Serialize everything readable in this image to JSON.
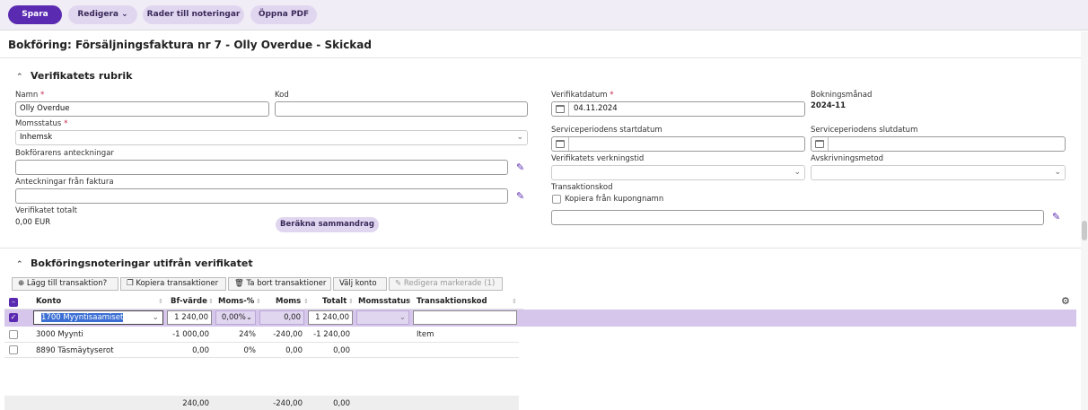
{
  "toolbar": {
    "save_label": "Spara",
    "edit_label": "Redigera",
    "rows_label": "Rader till noteringar",
    "pdf_label": "Öppna PDF"
  },
  "page": {
    "title": "Bokföring: Försäljningsfaktura nr 7 - Olly Overdue - Skickad"
  },
  "header_section": {
    "title": "Verifikatets rubrik",
    "name_label": "Namn",
    "name_value": "Olly Overdue",
    "code_label": "Kod",
    "code_value": "",
    "vat_status_label": "Momsstatus",
    "vat_status_value": "Inhemsk",
    "bookkeeper_notes_label": "Bokförarens anteckningar",
    "bookkeeper_notes_value": "",
    "invoice_notes_label": "Anteckningar från faktura",
    "invoice_notes_value": "",
    "total_label": "Verifikatet totalt",
    "total_value": "0,00 EUR",
    "calc_button": "Beräkna sammandrag",
    "date_label": "Verifikatdatum",
    "date_value": "04.11.2024",
    "booking_month_label": "Bokningsmånad",
    "booking_month_value": "2024-11",
    "service_start_label": "Serviceperiodens startdatum",
    "service_end_label": "Serviceperiodens slutdatum",
    "effect_time_label": "Verifikatets verkningstid",
    "depreciation_label": "Avskrivningsmetod",
    "transaction_code_label": "Transaktionskod",
    "copy_coupon_label": "Kopiera från kupongnamn",
    "required_mark": "*"
  },
  "entries_section": {
    "title": "Bokföringsnoteringar utifrån verifikatet",
    "buttons": {
      "add": "Lägg till transaktion?",
      "copy": "Kopiera transaktioner",
      "delete": "Ta bort transaktioner",
      "choose": "Välj konto",
      "edit_marked": "Redigera markerade (1)"
    },
    "columns": [
      "Konto",
      "Bf-värde",
      "Moms-%",
      "Moms",
      "Totalt",
      "Momsstatus",
      "Transaktionskod"
    ],
    "rows": [
      {
        "account": "1700 Myyntisaamiset",
        "bf": "1 240,00",
        "vat_pct": "0,00%",
        "vat": "0,00",
        "total": "1 240,00",
        "vat_status": "",
        "code": "",
        "selected": true
      },
      {
        "account": "3000 Myynti",
        "bf": "-1 000,00",
        "vat_pct": "24%",
        "vat": "-240,00",
        "total": "-1 240,00",
        "vat_status": "",
        "code": "Item",
        "selected": false
      },
      {
        "account": "8890 Täsmäytyserot",
        "bf": "0,00",
        "vat_pct": "0%",
        "vat": "0,00",
        "total": "0,00",
        "vat_status": "",
        "code": "",
        "selected": false
      }
    ],
    "footer": {
      "bf": "240,00",
      "vat": "-240,00",
      "total": "0,00"
    }
  },
  "icons": {
    "chevron": "chevron-up-icon",
    "edit": "pencil-icon",
    "calendar": "calendar-icon",
    "gear": "gear-icon"
  },
  "colors": {
    "primary": "#5a2ab0",
    "pill": "#e1d6f0",
    "selected_row": "#d6c6ec",
    "required": "#c0264c"
  }
}
